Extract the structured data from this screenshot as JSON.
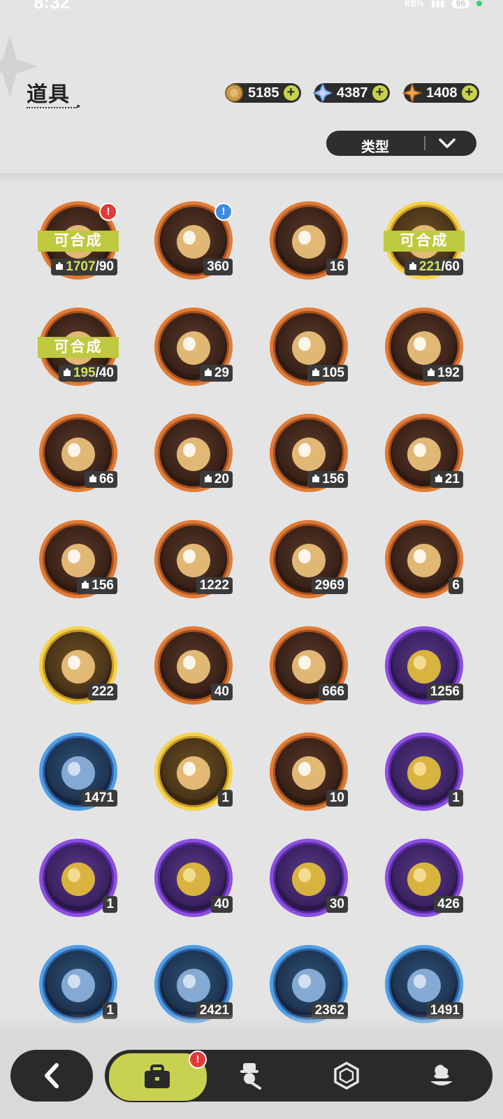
{
  "status_bar": {
    "time": "8:32",
    "net": "KB/s",
    "battery": "96"
  },
  "header": {
    "title": "道具",
    "filter_label": "类型"
  },
  "currencies": [
    {
      "icon": "gold-coin-icon",
      "value": "5185"
    },
    {
      "icon": "crystal-icon",
      "value": "4387"
    },
    {
      "icon": "amber-gem-icon",
      "value": "1408"
    }
  ],
  "combine_label": "可合成",
  "items": [
    {
      "frame": "orange",
      "icon": "bear-fragment-icon",
      "combinable": true,
      "puzzle": true,
      "have": "1707",
      "need": "/90",
      "badge": "red"
    },
    {
      "frame": "orange",
      "icon": "treasure-chest-icon",
      "count": "360",
      "badge": "blue"
    },
    {
      "frame": "orange",
      "icon": "purple-crystal-icon",
      "count": "16"
    },
    {
      "frame": "gold",
      "icon": "bear-fragment-icon",
      "combinable": true,
      "puzzle": true,
      "have": "221",
      "need": "/60"
    },
    {
      "frame": "orange",
      "icon": "bear-fragment-icon",
      "combinable": true,
      "puzzle": true,
      "have": "195",
      "need": "/40"
    },
    {
      "frame": "orange",
      "icon": "white-creature-icon",
      "puzzle": true,
      "count": "29"
    },
    {
      "frame": "orange",
      "icon": "fox-creature-icon",
      "puzzle": true,
      "count": "105"
    },
    {
      "frame": "orange",
      "icon": "teddy-bear-icon",
      "puzzle": true,
      "count": "192"
    },
    {
      "frame": "orange",
      "icon": "knight-creature-icon",
      "puzzle": true,
      "count": "66"
    },
    {
      "frame": "orange",
      "icon": "eyepatch-creature-icon",
      "puzzle": true,
      "count": "20"
    },
    {
      "frame": "orange",
      "icon": "bunny-creature-icon",
      "puzzle": true,
      "count": "156"
    },
    {
      "frame": "orange",
      "icon": "dark-bear-icon",
      "puzzle": true,
      "count": "21"
    },
    {
      "frame": "orange",
      "icon": "purple-creature-icon",
      "puzzle": true,
      "count": "156"
    },
    {
      "frame": "orange",
      "icon": "pink-star-crystal-icon",
      "count": "1222"
    },
    {
      "frame": "orange",
      "icon": "blue-star-crystal-icon",
      "count": "2969"
    },
    {
      "frame": "orange",
      "icon": "paw-pendant-icon",
      "count": "6"
    },
    {
      "frame": "gold",
      "icon": "gold-card-icon",
      "count": "222"
    },
    {
      "frame": "orange",
      "icon": "holo-card-icon",
      "count": "40"
    },
    {
      "frame": "orange",
      "icon": "orange-card-icon",
      "count": "666"
    },
    {
      "frame": "purple",
      "icon": "purple-card-icon",
      "count": "1256"
    },
    {
      "frame": "blue",
      "icon": "blue-card-icon",
      "count": "1471"
    },
    {
      "frame": "gold",
      "icon": "birthday-cake-icon",
      "count": "1"
    },
    {
      "frame": "orange",
      "icon": "clover-ticket-icon",
      "count": "10"
    },
    {
      "frame": "purple",
      "icon": "gold-horns-icon",
      "count": "1"
    },
    {
      "frame": "purple",
      "icon": "gift-box-icon",
      "count": "1"
    },
    {
      "frame": "purple",
      "icon": "gold-bell-icon",
      "count": "40"
    },
    {
      "frame": "purple",
      "icon": "scroll-icon",
      "count": "30"
    },
    {
      "frame": "purple",
      "icon": "peach-icon",
      "count": "426"
    },
    {
      "frame": "blue",
      "icon": "letter-icon",
      "count": "1"
    },
    {
      "frame": "blue",
      "icon": "shovel-icon",
      "count": "2421"
    },
    {
      "frame": "blue",
      "icon": "boxing-glove-icon",
      "count": "2362"
    },
    {
      "frame": "blue",
      "icon": "pickaxe-icon",
      "count": "1491"
    }
  ],
  "nav": {
    "back_icon": "back-arrow-icon",
    "tabs": [
      "bag-icon",
      "character-icon",
      "hexagon-icon",
      "dessert-icon"
    ],
    "badge": "!"
  },
  "colors": {
    "accent": "#c9d150",
    "orange_frame": "#e07b35",
    "purple_frame": "#8c4fe0",
    "blue_frame": "#4f9ee6",
    "gold_frame": "#f4d34a",
    "alert_red": "#e23a3a"
  }
}
